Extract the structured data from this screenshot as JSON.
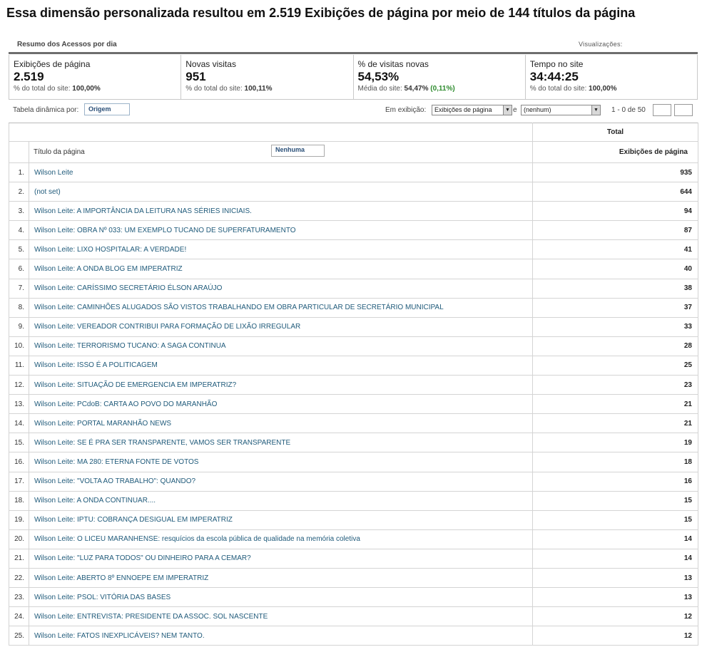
{
  "headline": "Essa dimensão personalizada resultou em 2.519 Exibições de página por meio de 144 títulos da página",
  "summary": {
    "label": "Resumo dos Acessos por dia",
    "visualizations_label": "Visualizações:"
  },
  "metrics": [
    {
      "name": "Exibições de página",
      "value": "2.519",
      "sub_prefix": "% do total do site:",
      "sub_value": "100,00%",
      "sub_delta": ""
    },
    {
      "name": "Novas visitas",
      "value": "951",
      "sub_prefix": "% do total do site:",
      "sub_value": "100,11%",
      "sub_delta": ""
    },
    {
      "name": "% de visitas novas",
      "value": "54,53%",
      "sub_prefix": "Média do site:",
      "sub_value": "54,47%",
      "sub_delta": "(0,11%)"
    },
    {
      "name": "Tempo no site",
      "value": "34:44:25",
      "sub_prefix": "% do total do site:",
      "sub_value": "100,00%",
      "sub_delta": ""
    }
  ],
  "controls": {
    "pivot_label": "Tabela dinâmica por:",
    "pivot_value": "Origem",
    "display_label": "Em exibição:",
    "display_value": "Exibições de página",
    "and_label": "e",
    "second_value": "(nenhum)",
    "range": "1 - 0 de 50"
  },
  "table": {
    "total_label": "Total",
    "col_title": "Título da página",
    "filter_value": "Nenhuma",
    "col_metric": "Exibições de página",
    "rows": [
      {
        "idx": "1.",
        "title": "Wilson Leite",
        "value": "935"
      },
      {
        "idx": "2.",
        "title": "(not set)",
        "value": "644"
      },
      {
        "idx": "3.",
        "title": "Wilson Leite: A IMPORTÂNCIA DA LEITURA NAS SÉRIES INICIAIS.",
        "value": "94"
      },
      {
        "idx": "4.",
        "title": "Wilson Leite: OBRA Nº 033: UM EXEMPLO TUCANO DE SUPERFATURAMENTO",
        "value": "87"
      },
      {
        "idx": "5.",
        "title": "Wilson Leite: LIXO HOSPITALAR: A VERDADE!",
        "value": "41"
      },
      {
        "idx": "6.",
        "title": "Wilson Leite: A ONDA BLOG EM IMPERATRIZ",
        "value": "40"
      },
      {
        "idx": "7.",
        "title": "Wilson Leite: CARÍSSIMO SECRETÁRIO ÉLSON ARAÚJO",
        "value": "38"
      },
      {
        "idx": "8.",
        "title": "Wilson Leite: CAMINHÕES ALUGADOS SÃO VISTOS TRABALHANDO EM OBRA PARTICULAR DE SECRETÁRIO MUNICIPAL",
        "value": "37"
      },
      {
        "idx": "9.",
        "title": "Wilson Leite: VEREADOR CONTRIBUI PARA FORMAÇÃO DE LIXÃO IRREGULAR",
        "value": "33"
      },
      {
        "idx": "10.",
        "title": "Wilson Leite: TERRORISMO TUCANO: A SAGA CONTINUA",
        "value": "28"
      },
      {
        "idx": "11.",
        "title": "Wilson Leite: ISSO É A POLITICAGEM",
        "value": "25"
      },
      {
        "idx": "12.",
        "title": "Wilson Leite: SITUAÇÃO DE EMERGENCIA EM IMPERATRIZ?",
        "value": "23"
      },
      {
        "idx": "13.",
        "title": "Wilson Leite: PCdoB: CARTA AO POVO DO MARANHÃO",
        "value": "21"
      },
      {
        "idx": "14.",
        "title": "Wilson Leite: PORTAL MARANHÃO NEWS",
        "value": "21"
      },
      {
        "idx": "15.",
        "title": "Wilson Leite: SE É PRA SER TRANSPARENTE, VAMOS SER TRANSPARENTE",
        "value": "19"
      },
      {
        "idx": "16.",
        "title": "Wilson Leite: MA 280: ETERNA FONTE DE VOTOS",
        "value": "18"
      },
      {
        "idx": "17.",
        "title": "Wilson Leite: \"VOLTA AO TRABALHO\": QUANDO?",
        "value": "16"
      },
      {
        "idx": "18.",
        "title": "Wilson Leite: A ONDA CONTINUAR....",
        "value": "15"
      },
      {
        "idx": "19.",
        "title": "Wilson Leite: IPTU: COBRANÇA DESIGUAL EM IMPERATRIZ",
        "value": "15"
      },
      {
        "idx": "20.",
        "title": "Wilson Leite: O LICEU MARANHENSE: resquícios da escola pública de qualidade na memória coletiva",
        "value": "14"
      },
      {
        "idx": "21.",
        "title": "Wilson Leite: \"LUZ PARA TODOS\" OU DINHEIRO PARA A CEMAR?",
        "value": "14"
      },
      {
        "idx": "22.",
        "title": "Wilson Leite: ABERTO 8º ENNOEPE EM IMPERATRIZ",
        "value": "13"
      },
      {
        "idx": "23.",
        "title": "Wilson Leite: PSOL: VITÓRIA DAS BASES",
        "value": "13"
      },
      {
        "idx": "24.",
        "title": "Wilson Leite: ENTREVISTA: PRESIDENTE DA ASSOC. SOL NASCENTE",
        "value": "12"
      },
      {
        "idx": "25.",
        "title": "Wilson Leite: FATOS INEXPLICÁVEIS? NEM TANTO.",
        "value": "12"
      }
    ]
  }
}
